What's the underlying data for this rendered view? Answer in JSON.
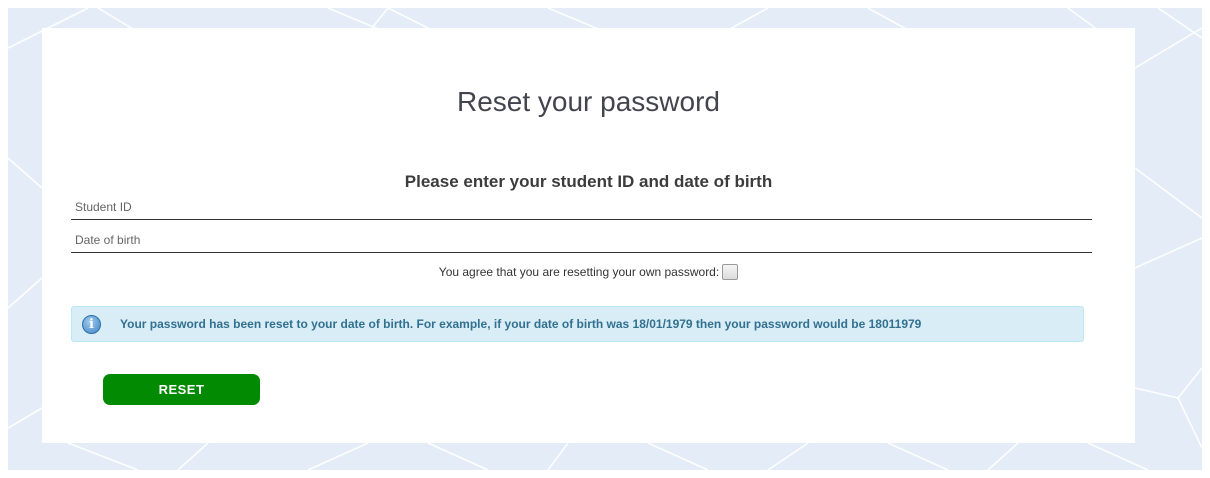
{
  "page": {
    "title": "Reset your password",
    "subtitle": "Please enter your student ID and date of birth"
  },
  "form": {
    "student_id": {
      "value": "",
      "placeholder": "Student ID"
    },
    "date_of_birth": {
      "value": "",
      "placeholder": "Date of birth"
    },
    "agree_label": "You agree that you are resetting your own password:",
    "agree_checked": false,
    "info_icon": "info-circle-icon",
    "info_message": "Your password has been reset to your date of birth. For example, if your date of birth was 18/01/1979 then your password would be 18011979",
    "reset_label": "RESET"
  },
  "colors": {
    "background": "#e4ecf8",
    "info_background": "#d9edf7",
    "info_text": "#31708f",
    "button": "#038a03"
  }
}
